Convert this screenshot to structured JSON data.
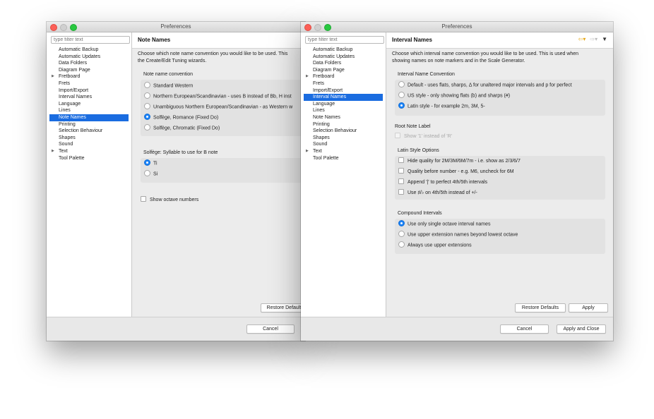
{
  "window1": {
    "title": "Preferences",
    "filter_placeholder": "type filter text",
    "tree": [
      "Automatic Backup",
      "Automatic Updates",
      "Data Folders",
      "Diagram Page",
      "Fretboard",
      "Frets",
      "Import/Export",
      "Interval Names",
      "Language",
      "Lines",
      "Note Names",
      "Printing",
      "Selection Behaviour",
      "Shapes",
      "Sound",
      "Text",
      "Tool Palette"
    ],
    "page_title": "Note Names",
    "desc_line1": "Choose which note name convention you would like to be used. This",
    "desc_line2": "the Create/Edit Tuning wizards.",
    "group1_title": "Note name convention",
    "group1_options": [
      "Standard Western",
      "Northern European/Scandinavian - uses B instead of Bb, H inst",
      "Unambiguous Northern European/Scandinavian - as Western w",
      "Solfège, Romance (Fixed Do)",
      "Solfège, Chromatic (Fixed Do)"
    ],
    "group2_title": "Solfège: Syllable to use for B note",
    "group2_options": [
      "Ti",
      "Si"
    ],
    "checkbox_label": "Show octave numbers",
    "restore_label": "Restore Default",
    "cancel_label": "Cancel"
  },
  "window2": {
    "title": "Preferences",
    "filter_placeholder": "type filter text",
    "tree": [
      "Automatic Backup",
      "Automatic Updates",
      "Data Folders",
      "Diagram Page",
      "Fretboard",
      "Frets",
      "Import/Export",
      "Interval Names",
      "Language",
      "Lines",
      "Note Names",
      "Printing",
      "Selection Behaviour",
      "Shapes",
      "Sound",
      "Text",
      "Tool Palette"
    ],
    "page_title": "Interval Names",
    "desc_line1": "Choose which interval name convention you would like to be used. This is used when",
    "desc_line2": "showing names on note markers and in the Scale Generator.",
    "group1_title": "Interval Name Convention",
    "group1_options": [
      "Default - uses flats, sharps, Δ for unaltered major intervals and p for perfect",
      "US style - only showing flats (b) and sharps (#)",
      "Latin style - for example 2m, 3M, 5-"
    ],
    "root_title": "Root Note Label",
    "root_option": "Show '1' instead of 'R'",
    "latin_title": "Latin Style Options",
    "latin_options": [
      "Hide quality for 2M/3M/6M/7m - i.e. show as 2/3/6/7",
      "Quality before number - e.g. M6, uncheck for 6M",
      "Append '|' to perfect 4th/5th intervals",
      "Use ♯/♭ on 4th/5th instead of +/-"
    ],
    "compound_title": "Compound Intervals",
    "compound_options": [
      "Use only single octave interval names",
      "Use upper extension names beyond lowest octave",
      "Always use upper extensions"
    ],
    "restore_label": "Restore Defaults",
    "apply_label": "Apply",
    "cancel_label": "Cancel",
    "apply_close_label": "Apply and Close"
  },
  "colors": {
    "selection": "#1a6ce0",
    "radio_on": "#1a82f7"
  }
}
